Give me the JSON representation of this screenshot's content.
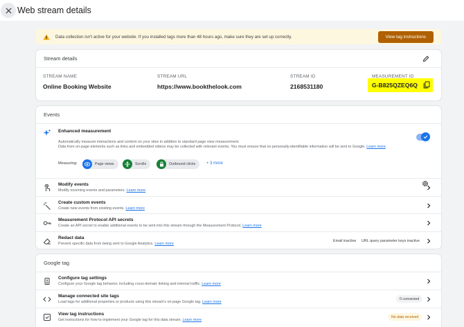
{
  "header": {
    "title": "Web stream details"
  },
  "alert": {
    "text": "Data collection isn't active for your website. If you installed tags more than 48 hours ago, make sure they are set up correctly.",
    "button": "View tag instructions"
  },
  "stream": {
    "title": "Stream details",
    "columns": [
      {
        "label": "STREAM NAME",
        "value": "Online Booking Website"
      },
      {
        "label": "STREAM URL",
        "value": "https://www.bookthelook.com"
      },
      {
        "label": "STREAM ID",
        "value": "2168531180"
      },
      {
        "label": "MEASUREMENT ID",
        "value": "G-B825QZEQ6Q"
      }
    ]
  },
  "events": {
    "title": "Events",
    "enhanced": {
      "title": "Enhanced measurement",
      "desc1": "Automatically measure interactions and content on your sites in addition to standard page view measurement.",
      "desc2": "Data from on-page elements such as links and embedded videos may be collected with relevant events. You must ensure that no personally-identifiable information will be sent to Google.",
      "learn": "Learn more",
      "measuring_label": "Measuring:",
      "chips": [
        "Page views",
        "Scrolls",
        "Outbound clicks"
      ],
      "more": "+ 3 more"
    },
    "rows": [
      {
        "title": "Modify events",
        "desc": "Modify incoming events and parameters.",
        "learn": "Learn more"
      },
      {
        "title": "Create custom events",
        "desc": "Create new events from existing events.",
        "learn": "Learn more"
      },
      {
        "title": "Measurement Protocol API secrets",
        "desc": "Create an API secret to enable additional events to be sent into this stream through the Measurement Protocol.",
        "learn": "Learn more"
      },
      {
        "title": "Redact data",
        "desc": "Prevent specific data from being sent to Google Analytics.",
        "learn": "Learn more",
        "status1": "Email inactive",
        "status2": "URL query parameter keys inactive"
      }
    ]
  },
  "gtag": {
    "title": "Google tag",
    "rows": [
      {
        "title": "Configure tag settings",
        "desc": "Configure your Google tag behavior, including cross-domain linking and internal traffic.",
        "learn": "Learn more"
      },
      {
        "title": "Manage connected site tags",
        "desc": "Load tags for additional properties or products using this stream's on-page Google tag.",
        "learn": "Learn more",
        "badge": "0 connected"
      },
      {
        "title": "View tag instructions",
        "desc": "Get instructions for how to implement your Google tag for this data stream.",
        "learn": "Learn more",
        "badge": "No data received"
      }
    ]
  },
  "colors": {
    "accent": "#1a73e8",
    "warn": "#b06000",
    "highlight": "#ffff00"
  }
}
